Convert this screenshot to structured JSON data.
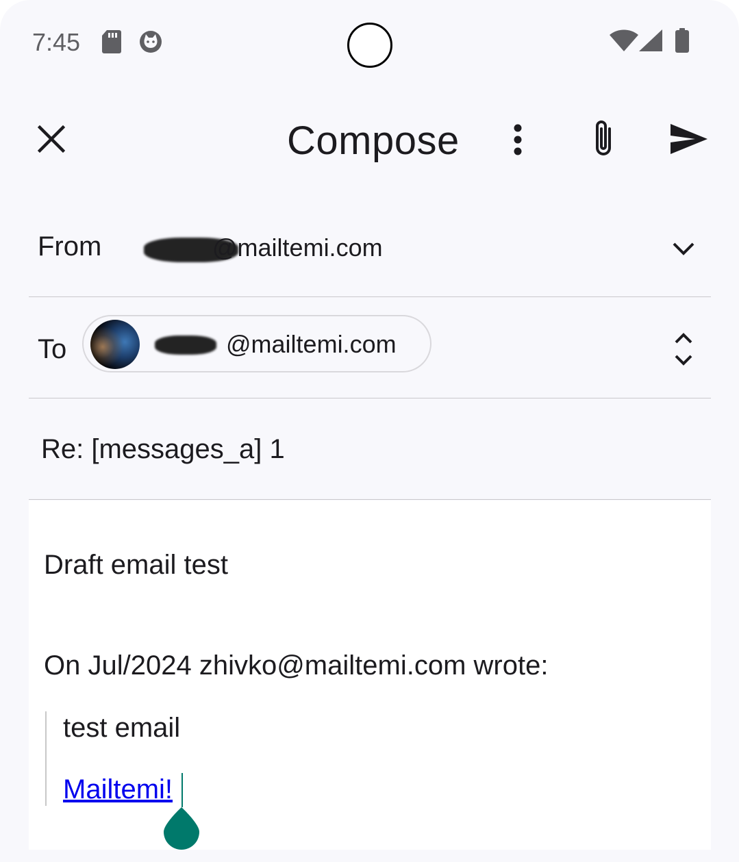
{
  "status_bar": {
    "time": "7:45",
    "icons": [
      "sd-card-icon",
      "cat-notification-icon",
      "wifi-icon",
      "cell-signal-icon",
      "battery-icon"
    ]
  },
  "app_bar": {
    "title": "Compose",
    "actions": [
      "close-icon",
      "more-vert-icon",
      "attach-icon",
      "send-icon"
    ]
  },
  "from": {
    "label": "From",
    "value": "@mailtemi.com"
  },
  "to": {
    "label": "To",
    "recipient": "@mailtemi.com"
  },
  "subject": {
    "value": "Re: [messages_a] 1"
  },
  "body": {
    "draft_text": "Draft email test",
    "wrote_line": "On Jul/2024 zhivko@mailtemi.com wrote:",
    "quote_text": "test email",
    "quote_link": "Mailtemi!"
  },
  "colors": {
    "background": "#f8f8fc",
    "accent": "#00796b",
    "link": "#0000ee"
  }
}
